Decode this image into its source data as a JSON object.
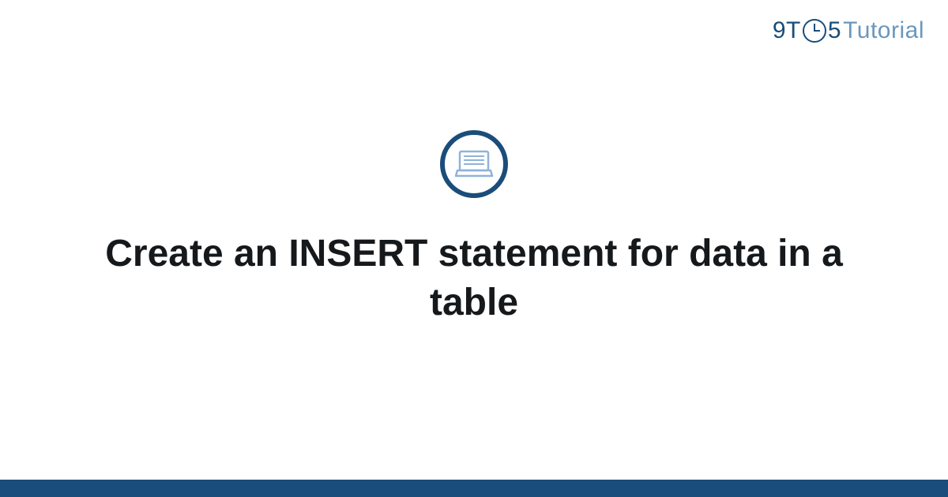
{
  "brand": {
    "part1": "9T",
    "part2": "5",
    "part3": "Tutorial"
  },
  "main": {
    "title": "Create an INSERT statement for data in a table"
  },
  "colors": {
    "brandPrimary": "#1a4d7a",
    "brandSecondary": "#6b97bd",
    "titleColor": "#16191c",
    "iconAccent": "#8fb3d9"
  }
}
